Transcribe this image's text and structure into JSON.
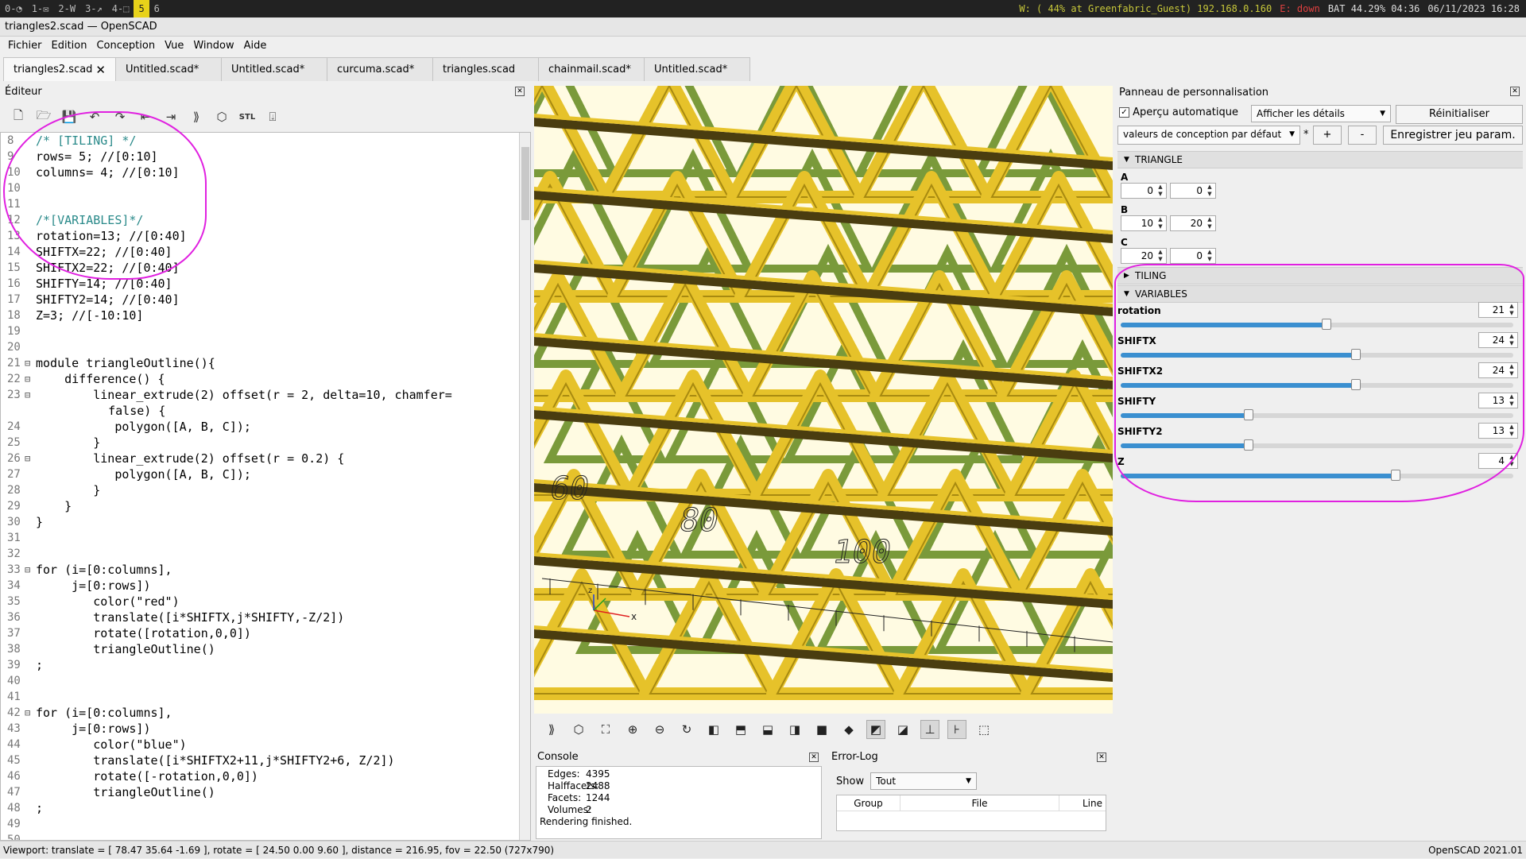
{
  "topbar": {
    "workspaces": [
      "0-◔",
      "1-✉",
      "2-W",
      "3-↗",
      "4-⬚",
      "5",
      "6"
    ],
    "active_workspace": 5,
    "wifi": "W: ( 44% at Greenfabric_Guest) 192.168.0.160",
    "eth": "E: down",
    "battery": "BAT 44.29% 04:36",
    "datetime": "06/11/2023 16:28"
  },
  "window_title": "triangles2.scad — OpenSCAD",
  "menu": [
    "Fichier",
    "Edition",
    "Conception",
    "Vue",
    "Window",
    "Aide"
  ],
  "tabs": [
    "triangles2.scad",
    "Untitled.scad*",
    "Untitled.scad*",
    "curcuma.scad*",
    "triangles.scad",
    "chainmail.scad*",
    "Untitled.scad*"
  ],
  "editor": {
    "title": "Éditeur",
    "toolbar_icons": [
      "new-file-icon",
      "open-file-icon",
      "save-file-icon",
      "undo-icon",
      "redo-icon",
      "unindent-icon",
      "indent-icon",
      "preview-icon",
      "render-icon",
      "export-stl-icon",
      "send-to-printer-icon"
    ],
    "stl_label": "STL",
    "lines": [
      {
        "n": "8",
        "fold": "",
        "t": "/* [TILING] */",
        "c": "cmt"
      },
      {
        "n": "9",
        "fold": "",
        "t": "rows= 5; //[0:10]",
        "c": ""
      },
      {
        "n": "10",
        "fold": "",
        "t": "columns= 4; //[0:10]",
        "c": ""
      },
      {
        "n": "10",
        "fold": "",
        "t": "",
        "c": ""
      },
      {
        "n": "11",
        "fold": "",
        "t": "",
        "c": ""
      },
      {
        "n": "12",
        "fold": "",
        "t": "/*[VARIABLES]*/",
        "c": "cmt"
      },
      {
        "n": "13",
        "fold": "",
        "t": "rotation=13; //[0:40]",
        "c": ""
      },
      {
        "n": "14",
        "fold": "",
        "t": "SHIFTX=22; //[0:40]",
        "c": ""
      },
      {
        "n": "15",
        "fold": "",
        "t": "SHIFTX2=22; //[0:40]",
        "c": ""
      },
      {
        "n": "16",
        "fold": "",
        "t": "SHIFTY=14; //[0:40]",
        "c": ""
      },
      {
        "n": "17",
        "fold": "",
        "t": "SHIFTY2=14; //[0:40]",
        "c": ""
      },
      {
        "n": "18",
        "fold": "",
        "t": "Z=3; //[-10:10]",
        "c": ""
      },
      {
        "n": "19",
        "fold": "",
        "t": "",
        "c": ""
      },
      {
        "n": "20",
        "fold": "",
        "t": "",
        "c": ""
      },
      {
        "n": "21",
        "fold": "⊟",
        "t": "module triangleOutline(){",
        "c": ""
      },
      {
        "n": "22",
        "fold": "⊟",
        "t": "    difference() {",
        "c": ""
      },
      {
        "n": "23",
        "fold": "⊟",
        "t": "        linear_extrude(2) offset(r = 2, delta=10, chamfer=",
        "c": ""
      },
      {
        "n": "",
        "fold": "",
        "t": "    false) {",
        "c": ""
      },
      {
        "n": "24",
        "fold": "",
        "t": "           polygon([A, B, C]);",
        "c": ""
      },
      {
        "n": "25",
        "fold": "",
        "t": "        }",
        "c": ""
      },
      {
        "n": "26",
        "fold": "⊟",
        "t": "        linear_extrude(2) offset(r = 0.2) {",
        "c": ""
      },
      {
        "n": "27",
        "fold": "",
        "t": "           polygon([A, B, C]);",
        "c": ""
      },
      {
        "n": "28",
        "fold": "",
        "t": "        }",
        "c": ""
      },
      {
        "n": "29",
        "fold": "",
        "t": "    }",
        "c": ""
      },
      {
        "n": "30",
        "fold": "",
        "t": "}",
        "c": ""
      },
      {
        "n": "31",
        "fold": "",
        "t": "",
        "c": ""
      },
      {
        "n": "32",
        "fold": "",
        "t": "",
        "c": ""
      },
      {
        "n": "33",
        "fold": "⊟",
        "t": "for (i=[0:columns],",
        "c": ""
      },
      {
        "n": "34",
        "fold": "",
        "t": "     j=[0:rows])",
        "c": ""
      },
      {
        "n": "35",
        "fold": "",
        "t": "        color(\"red\")",
        "c": ""
      },
      {
        "n": "36",
        "fold": "",
        "t": "        translate([i*SHIFTX,j*SHIFTY,-Z/2])",
        "c": ""
      },
      {
        "n": "37",
        "fold": "",
        "t": "        rotate([rotation,0,0])",
        "c": ""
      },
      {
        "n": "38",
        "fold": "",
        "t": "        triangleOutline()",
        "c": ""
      },
      {
        "n": "39",
        "fold": "",
        "t": ";",
        "c": ""
      },
      {
        "n": "40",
        "fold": "",
        "t": "",
        "c": ""
      },
      {
        "n": "41",
        "fold": "",
        "t": "",
        "c": ""
      },
      {
        "n": "42",
        "fold": "⊟",
        "t": "for (i=[0:columns],",
        "c": ""
      },
      {
        "n": "43",
        "fold": "",
        "t": "     j=[0:rows])",
        "c": ""
      },
      {
        "n": "44",
        "fold": "",
        "t": "        color(\"blue\")",
        "c": ""
      },
      {
        "n": "45",
        "fold": "",
        "t": "        translate([i*SHIFTX2+11,j*SHIFTY2+6, Z/2])",
        "c": ""
      },
      {
        "n": "46",
        "fold": "",
        "t": "        rotate([-rotation,0,0])",
        "c": ""
      },
      {
        "n": "47",
        "fold": "",
        "t": "        triangleOutline()",
        "c": ""
      },
      {
        "n": "48",
        "fold": "",
        "t": ";",
        "c": ""
      },
      {
        "n": "49",
        "fold": "",
        "t": "",
        "c": ""
      },
      {
        "n": "50",
        "fold": "",
        "t": "",
        "c": ""
      }
    ]
  },
  "viewport": {
    "axis_labels": [
      "60",
      "80",
      "100"
    ],
    "axis_x": "x",
    "axis_z": "z"
  },
  "view_toolbar_icons": [
    "preview-icon",
    "render-icon",
    "view-all-icon",
    "zoom-in-icon",
    "zoom-out-icon",
    "reset-view-icon",
    "view-right-icon",
    "view-top-icon",
    "view-bottom-icon",
    "view-left-icon",
    "view-front-icon",
    "view-back-icon",
    "perspective-icon",
    "orthogonal-icon",
    "show-axes-icon",
    "show-scale-icon",
    "show-edges-icon"
  ],
  "console": {
    "title": "Console",
    "rows": [
      {
        "k": "Edges:",
        "v": "4395"
      },
      {
        "k": "Halffacets:",
        "v": "2488"
      },
      {
        "k": "Facets:",
        "v": "1244"
      },
      {
        "k": "Volumes:",
        "v": "2"
      }
    ],
    "status": "Rendering finished."
  },
  "errlog": {
    "title": "Error-Log",
    "show_label": "Show",
    "show_value": "Tout",
    "columns": [
      "Group",
      "File",
      "Line"
    ]
  },
  "customizer": {
    "title": "Panneau de personnalisation",
    "auto_preview_label": "Aperçu automatique",
    "details_select": "Afficher les détails",
    "reset_button": "Réinitialiser",
    "preset_select": "valeurs de conception par défaut",
    "asterisk": "*",
    "plus": "+",
    "minus": "-",
    "save_button": "Enregistrer jeu param.",
    "sections": {
      "triangle": "TRIANGLE",
      "tiling": "TILING",
      "variables": "VARIABLES"
    },
    "vectors": [
      {
        "label": "A",
        "a": "0",
        "b": "0"
      },
      {
        "label": "B",
        "a": "10",
        "b": "20"
      },
      {
        "label": "C",
        "a": "20",
        "b": "0"
      }
    ],
    "sliders": [
      {
        "label": "rotation",
        "value": "21",
        "frac": 0.525
      },
      {
        "label": "SHIFTX",
        "value": "24",
        "frac": 0.6
      },
      {
        "label": "SHIFTX2",
        "value": "24",
        "frac": 0.6
      },
      {
        "label": "SHIFTY",
        "value": "13",
        "frac": 0.325
      },
      {
        "label": "SHIFTY2",
        "value": "13",
        "frac": 0.325
      },
      {
        "label": "Z",
        "value": "4",
        "frac": 0.7
      }
    ]
  },
  "statusbar": {
    "viewport_info": "Viewport: translate = [ 78.47 35.64 -1.69 ], rotate = [ 24.50 0.00 9.60 ], distance = 216.95, fov = 22.50 (727x790)",
    "version": "OpenSCAD 2021.01"
  },
  "colors": {
    "part_yellow": "#e6c22a",
    "part_dark": "#4a3d10",
    "part_green": "#7a9a3a",
    "viewport_bg": "#fffbe2",
    "annotation_magenta": "#e020e0",
    "slider_blue": "#3a8fd0"
  }
}
